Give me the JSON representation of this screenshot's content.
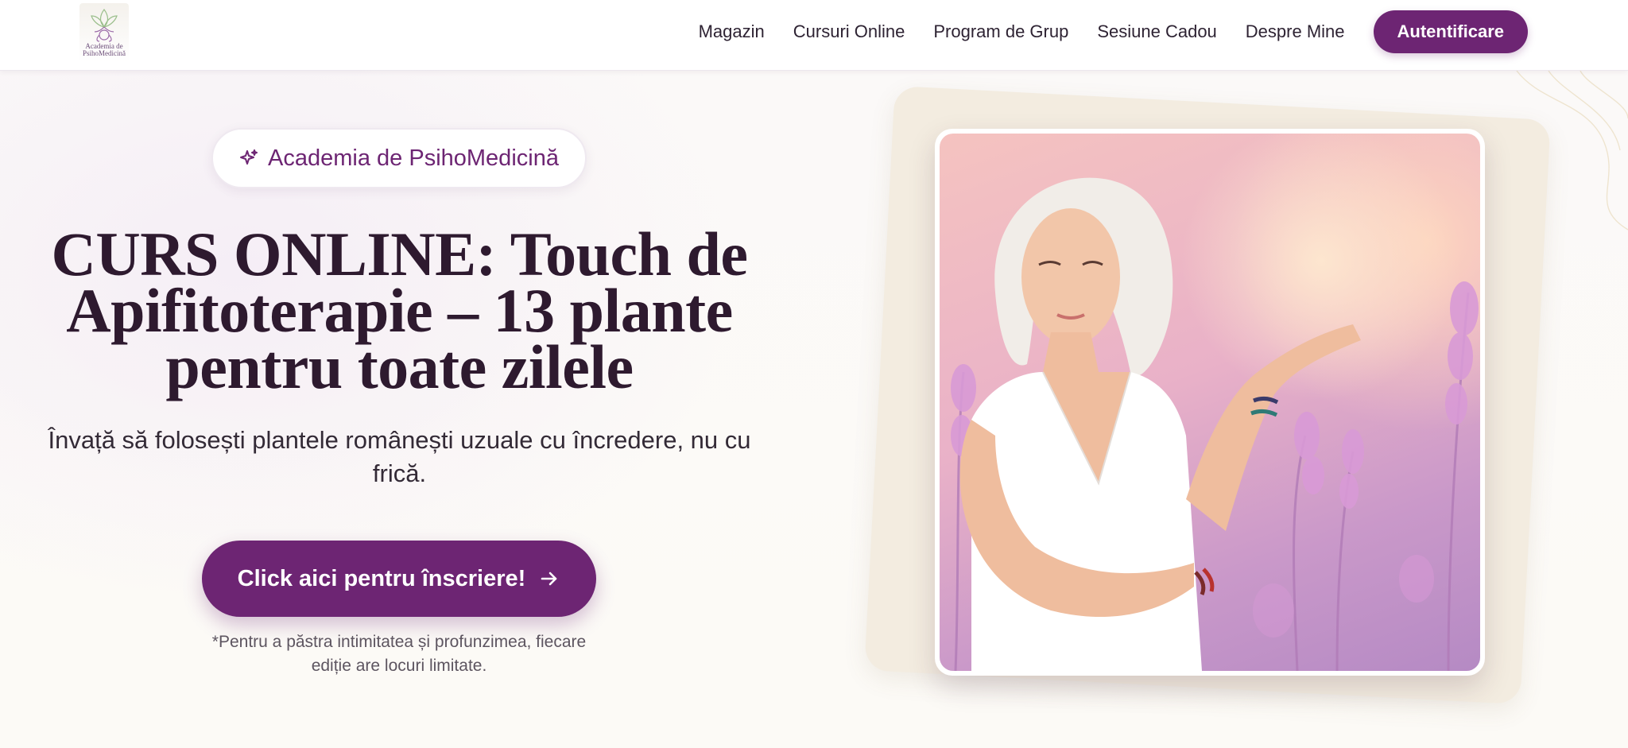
{
  "header": {
    "logo": {
      "line1": "Academia de",
      "line2": "PsihoMedicină"
    },
    "nav": [
      "Magazin",
      "Cursuri Online",
      "Program de Grup",
      "Sesiune Cadou",
      "Despre Mine"
    ],
    "login_label": "Autentificare"
  },
  "hero": {
    "badge": "Academia de PsihoMedicină",
    "title": "CURS ONLINE: Touch de Apifitoterapie – 13 plante pentru toate zilele",
    "subtitle": "Învață să folosești plantele românești uzuale cu încredere, nu cu frică.",
    "cta_label": "Click aici pentru înscriere!",
    "note": "*Pentru a păstra intimitatea și profunzimea, fiecare ediție are locuri limitate."
  },
  "colors": {
    "brand": "#6d2573",
    "title_text": "#2e1a2f",
    "card_back": "#f3ece0"
  },
  "icons": {
    "badge": "sparkles-icon",
    "cta": "arrow-right-icon",
    "logo": "lotus-icon"
  }
}
